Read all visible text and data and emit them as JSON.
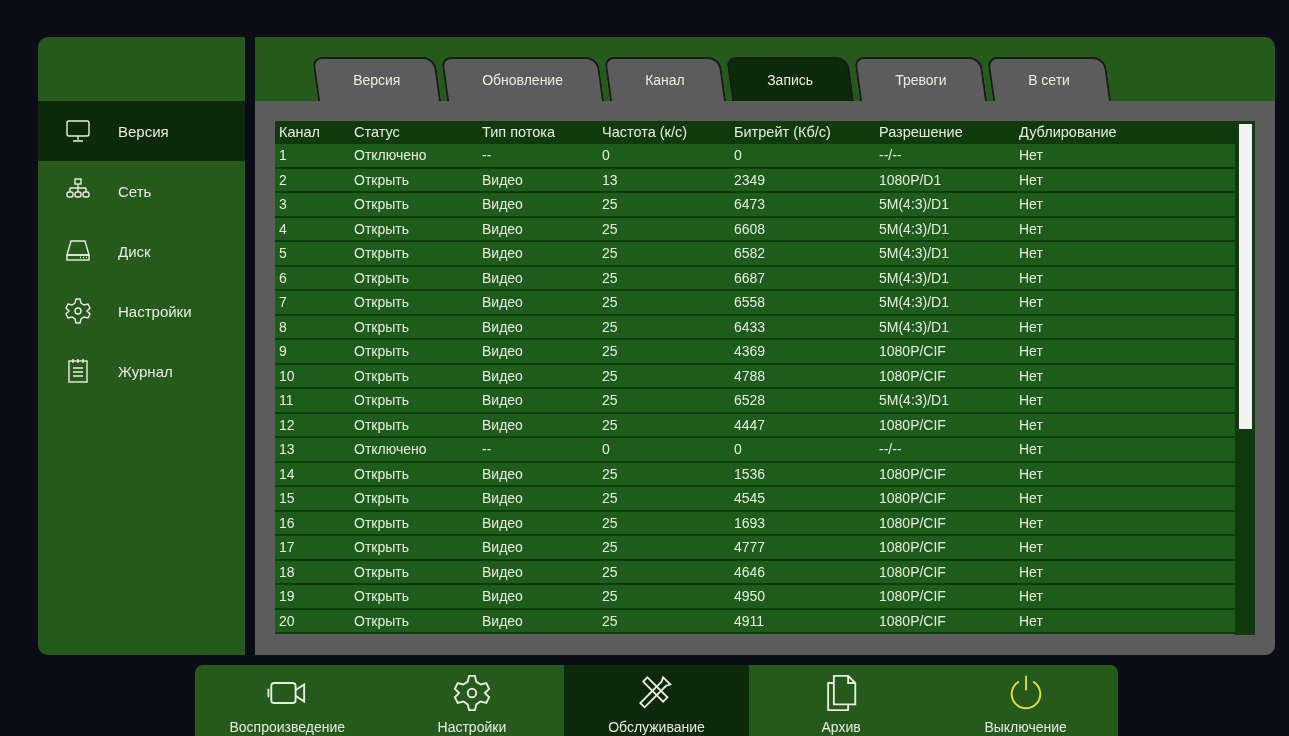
{
  "sidebar": {
    "items": [
      {
        "label": "Версия",
        "selected": true
      },
      {
        "label": "Сеть",
        "selected": false
      },
      {
        "label": "Диск",
        "selected": false
      },
      {
        "label": "Настройки",
        "selected": false
      },
      {
        "label": "Журнал",
        "selected": false
      }
    ]
  },
  "tabs": [
    {
      "label": "Версия",
      "selected": false
    },
    {
      "label": "Обновление",
      "selected": false
    },
    {
      "label": "Канал",
      "selected": false
    },
    {
      "label": "Запись",
      "selected": true
    },
    {
      "label": "Тревоги",
      "selected": false
    },
    {
      "label": "В сети",
      "selected": false
    }
  ],
  "table": {
    "columns": [
      "Канал",
      "Статус",
      "Тип потока",
      "Частота (к/с)",
      "Битрейт (Кб/с)",
      "Разрешение",
      "Дублирование"
    ],
    "rows": [
      [
        "1",
        "Отключено",
        "--",
        "0",
        "0",
        "--/--",
        "Нет"
      ],
      [
        "2",
        "Открыть",
        "Видео",
        "13",
        "2349",
        "1080P/D1",
        "Нет"
      ],
      [
        "3",
        "Открыть",
        "Видео",
        "25",
        "6473",
        "5M(4:3)/D1",
        "Нет"
      ],
      [
        "4",
        "Открыть",
        "Видео",
        "25",
        "6608",
        "5M(4:3)/D1",
        "Нет"
      ],
      [
        "5",
        "Открыть",
        "Видео",
        "25",
        "6582",
        "5M(4:3)/D1",
        "Нет"
      ],
      [
        "6",
        "Открыть",
        "Видео",
        "25",
        "6687",
        "5M(4:3)/D1",
        "Нет"
      ],
      [
        "7",
        "Открыть",
        "Видео",
        "25",
        "6558",
        "5M(4:3)/D1",
        "Нет"
      ],
      [
        "8",
        "Открыть",
        "Видео",
        "25",
        "6433",
        "5M(4:3)/D1",
        "Нет"
      ],
      [
        "9",
        "Открыть",
        "Видео",
        "25",
        "4369",
        "1080P/CIF",
        "Нет"
      ],
      [
        "10",
        "Открыть",
        "Видео",
        "25",
        "4788",
        "1080P/CIF",
        "Нет"
      ],
      [
        "11",
        "Открыть",
        "Видео",
        "25",
        "6528",
        "5M(4:3)/D1",
        "Нет"
      ],
      [
        "12",
        "Открыть",
        "Видео",
        "25",
        "4447",
        "1080P/CIF",
        "Нет"
      ],
      [
        "13",
        "Отключено",
        "--",
        "0",
        "0",
        "--/--",
        "Нет"
      ],
      [
        "14",
        "Открыть",
        "Видео",
        "25",
        "1536",
        "1080P/CIF",
        "Нет"
      ],
      [
        "15",
        "Открыть",
        "Видео",
        "25",
        "4545",
        "1080P/CIF",
        "Нет"
      ],
      [
        "16",
        "Открыть",
        "Видео",
        "25",
        "1693",
        "1080P/CIF",
        "Нет"
      ],
      [
        "17",
        "Открыть",
        "Видео",
        "25",
        "4777",
        "1080P/CIF",
        "Нет"
      ],
      [
        "18",
        "Открыть",
        "Видео",
        "25",
        "4646",
        "1080P/CIF",
        "Нет"
      ],
      [
        "19",
        "Открыть",
        "Видео",
        "25",
        "4950",
        "1080P/CIF",
        "Нет"
      ],
      [
        "20",
        "Открыть",
        "Видео",
        "25",
        "4911",
        "1080P/CIF",
        "Нет"
      ]
    ]
  },
  "bottom_bar": {
    "items": [
      {
        "label": "Воспроизведение",
        "selected": false
      },
      {
        "label": "Настройки",
        "selected": false
      },
      {
        "label": "Обслуживание",
        "selected": true
      },
      {
        "label": "Архив",
        "selected": false
      },
      {
        "label": "Выключение",
        "selected": false
      }
    ]
  }
}
